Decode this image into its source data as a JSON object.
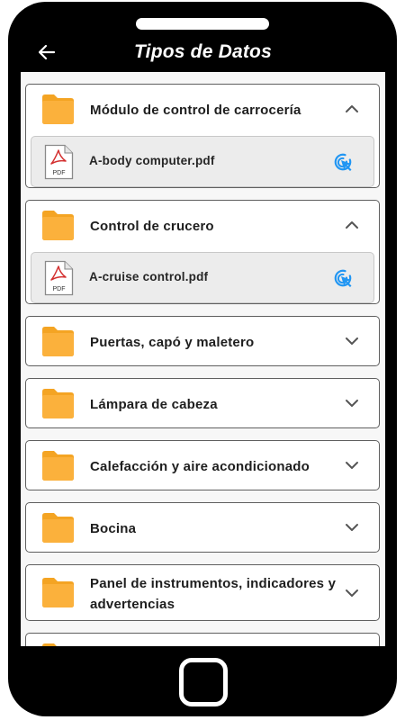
{
  "header": {
    "title": "Tipos de Datos",
    "back_icon": "arrow-left-icon"
  },
  "categories": [
    {
      "label": "Módulo de control de carrocería",
      "expanded": true,
      "file": "A-body computer.pdf"
    },
    {
      "label": "Control de crucero",
      "expanded": true,
      "file": "A-cruise control.pdf"
    },
    {
      "label": "Puertas, capó y maletero",
      "expanded": false
    },
    {
      "label": "Lámpara de cabeza",
      "expanded": false
    },
    {
      "label": "Calefacción y aire acondicionado",
      "expanded": false
    },
    {
      "label": "Bocina",
      "expanded": false
    },
    {
      "label": "Panel de instrumentos, indicadores y advertencias",
      "expanded": false
    }
  ],
  "pdf_icon_text": "PDF",
  "colors": {
    "folder": "#fbb13c",
    "folder_tab": "#f4a423",
    "pdf_red": "#d32f2f",
    "open_icon": "#2196f3",
    "frame": "#000000",
    "screen_bg": "#f7f7f7"
  }
}
